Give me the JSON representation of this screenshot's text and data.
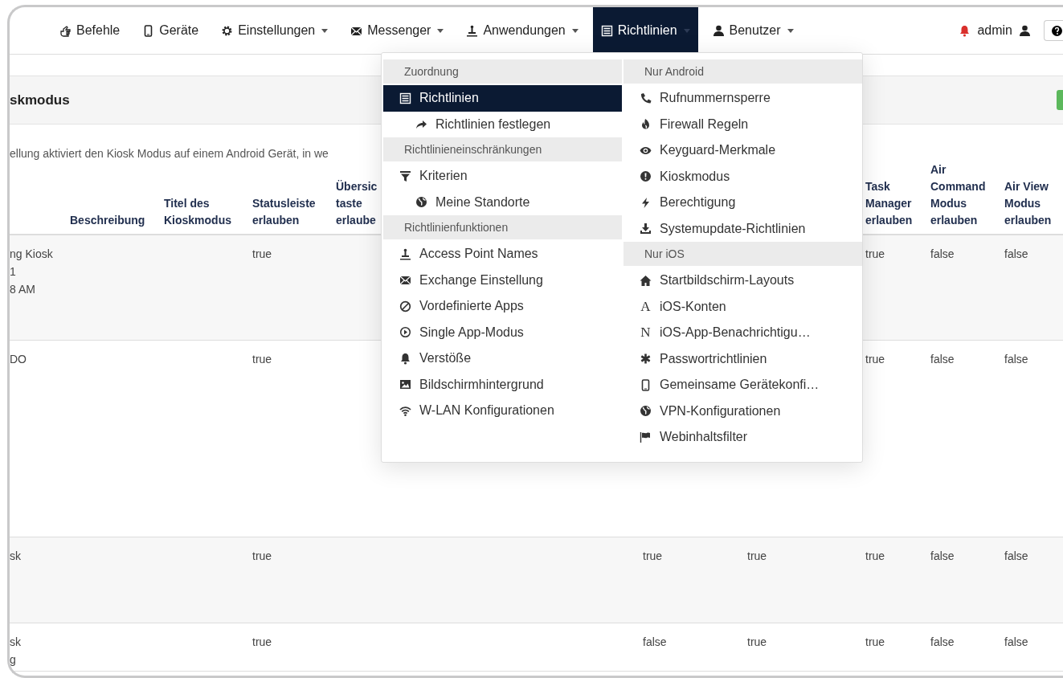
{
  "navbar": {
    "items": [
      {
        "label": "Befehle",
        "dropdown": false,
        "selected": false
      },
      {
        "label": "Geräte",
        "dropdown": false,
        "selected": false
      },
      {
        "label": "Einstellungen",
        "dropdown": true,
        "selected": false
      },
      {
        "label": "Messenger",
        "dropdown": true,
        "selected": false
      },
      {
        "label": "Anwendungen",
        "dropdown": true,
        "selected": false
      },
      {
        "label": "Richtlinien",
        "dropdown": true,
        "selected": true
      },
      {
        "label": "Benutzer",
        "dropdown": true,
        "selected": false
      }
    ],
    "user": "admin"
  },
  "panel": {
    "title": "skmodus",
    "description": "ellung aktiviert den Kiosk Modus auf einem Android Gerät, in we"
  },
  "table": {
    "columns": [
      "",
      "Beschreibung",
      "Titel des\nKioskmodus",
      "Statusleiste\nerlauben",
      "Übersic\ntaste\nerlaube",
      null,
      null,
      "Task\nManager\nerlauben",
      "Air\nCommand\nModus\nerlauben",
      "Air View\nModus\nerlauben"
    ],
    "rows": [
      {
        "cells": [
          "ng Kiosk\n1\n8 AM",
          null,
          null,
          "true",
          null,
          null,
          null,
          "true",
          "false",
          "false"
        ]
      },
      {
        "cells": [
          "DO",
          null,
          null,
          "true",
          null,
          null,
          null,
          "true",
          "false",
          "false"
        ]
      },
      {
        "cells": [
          "sk",
          null,
          null,
          "true",
          null,
          "true",
          "true",
          "true",
          "false",
          "false"
        ]
      },
      {
        "cells": [
          "sk\ng",
          null,
          null,
          "true",
          null,
          "false",
          "true",
          "true",
          "false",
          "false"
        ]
      }
    ]
  },
  "menu": {
    "columns": [
      {
        "sections": [
          {
            "header": "Zuordnung",
            "items": [
              {
                "label": "Richtlinien",
                "selected": true,
                "children": [
                  {
                    "label": "Richtlinien festlegen",
                    "selected": false
                  }
                ]
              }
            ]
          },
          {
            "header": "Richtlinieneinschränkungen",
            "items": [
              {
                "label": "Kriterien",
                "selected": false,
                "children": [
                  {
                    "label": "Meine Standorte",
                    "selected": false
                  }
                ]
              }
            ]
          },
          {
            "header": "Richtlinienfunktionen",
            "items": [
              {
                "label": "Access Point Names",
                "selected": false
              },
              {
                "label": "Exchange Einstellung",
                "selected": false
              },
              {
                "label": "Vordefinierte Apps",
                "selected": false
              },
              {
                "label": "Single App-Modus",
                "selected": false
              },
              {
                "label": "Verstöße",
                "selected": false
              },
              {
                "label": "Bildschirmhintergrund",
                "selected": false
              },
              {
                "label": "W-LAN Konfigurationen",
                "selected": false
              }
            ]
          }
        ]
      },
      {
        "sections": [
          {
            "header": "Nur Android",
            "items": [
              {
                "label": "Rufnummernsperre",
                "selected": false
              },
              {
                "label": "Firewall Regeln",
                "selected": false
              },
              {
                "label": "Keyguard-Merkmale",
                "selected": false
              },
              {
                "label": "Kioskmodus",
                "selected": false
              },
              {
                "label": "Berechtigung",
                "selected": false
              },
              {
                "label": "Systemupdate-Richtlinien",
                "selected": false
              }
            ]
          },
          {
            "header": "Nur iOS",
            "items": [
              {
                "label": "Startbildschirm-Layouts",
                "selected": false
              },
              {
                "label": "iOS-Konten",
                "glyph": "A",
                "selected": false
              },
              {
                "label": "iOS-App-Benachrichtigu…",
                "glyph": "N",
                "selected": false
              },
              {
                "label": "Passwortrichtlinien",
                "selected": false
              },
              {
                "label": "Gemeinsame Gerätekonfi…",
                "selected": false
              },
              {
                "label": "VPN-Konfigurationen",
                "selected": false
              },
              {
                "label": "Webinhaltsfilter",
                "selected": false
              }
            ]
          }
        ]
      }
    ]
  }
}
